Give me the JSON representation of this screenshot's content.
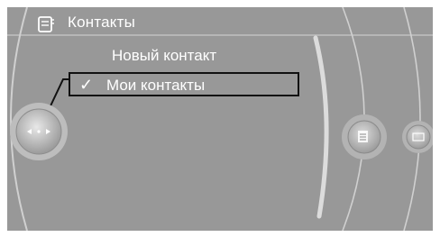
{
  "header": {
    "title": "Контакты",
    "icon": "contacts-book-icon"
  },
  "menu": {
    "items": [
      {
        "label": "Новый контакт",
        "selected": false
      },
      {
        "label": "Мои контакты",
        "selected": true,
        "check": "✓"
      }
    ]
  },
  "controller": {
    "icon": "controller-knob-icon",
    "left_arrow": "◀",
    "right_arrow": "▶"
  },
  "side_buttons": [
    {
      "icon": "contacts-list-icon"
    },
    {
      "icon": "card-icon"
    }
  ],
  "colors": {
    "background": "#989898",
    "text": "#ffffff",
    "highlight_border": "#111111"
  }
}
